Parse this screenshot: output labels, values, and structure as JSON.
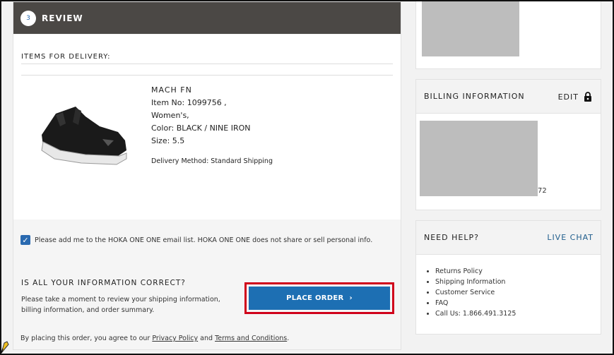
{
  "review": {
    "step_number": "3",
    "title": "REVIEW"
  },
  "items": {
    "section_label": "ITEMS FOR DELIVERY:",
    "product": {
      "name": "MACH FN",
      "item_no": "Item No: 1099756 ,",
      "gender": "Women's,",
      "color": "Color: BLACK / NINE IRON",
      "size": "Size: 5.5",
      "delivery": "Delivery Method: Standard Shipping"
    }
  },
  "email_optin": {
    "checked": true,
    "label": "Please add me to the HOKA ONE ONE email list. HOKA ONE ONE does not share or sell personal info."
  },
  "confirm": {
    "question": "IS ALL YOUR INFORMATION CORRECT?",
    "description": "Please take a moment to review your shipping information, billing information, and order summary.",
    "place_order_label": "PLACE ORDER"
  },
  "agreement": {
    "prefix": "By placing this order, you agree to our",
    "privacy_link": "Privacy Policy",
    "and": "and",
    "terms_link": "Terms and Conditions",
    "suffix": "."
  },
  "billing": {
    "title": "BILLING INFORMATION",
    "edit_label": "EDIT",
    "card_last_digits": "72"
  },
  "help": {
    "title": "NEED HELP?",
    "live_chat": "LIVE CHAT",
    "links": [
      "Returns Policy",
      "Shipping Information",
      "Customer Service",
      "FAQ",
      "Call Us: 1.866.491.3125"
    ]
  },
  "colors": {
    "header_bg": "#4b4845",
    "accent_blue": "#1d6fb3",
    "highlight_red": "#d0021b",
    "link_blue": "#1f5d8c"
  }
}
